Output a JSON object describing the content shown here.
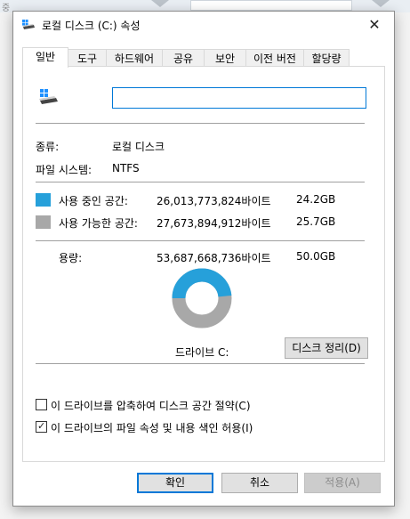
{
  "background": {
    "peek_text": "중"
  },
  "window": {
    "title": "로컬 디스크 (C:) 속성",
    "close_glyph": "✕"
  },
  "tabs": [
    {
      "label": "일반",
      "active": true
    },
    {
      "label": "도구"
    },
    {
      "label": "하드웨어"
    },
    {
      "label": "공유"
    },
    {
      "label": "보안"
    },
    {
      "label": "이전 버전"
    },
    {
      "label": "할당량"
    }
  ],
  "general": {
    "name_value": "",
    "type_label": "종류:",
    "type_value": "로컬 디스크",
    "fs_label": "파일 시스템:",
    "fs_value": "NTFS",
    "used": {
      "label": "사용 중인 공간:",
      "bytes": "26,013,773,824바이트",
      "size": "24.2GB",
      "color": "#26a0da"
    },
    "free": {
      "label": "사용 가능한 공간:",
      "bytes": "27,673,894,912바이트",
      "size": "25.7GB",
      "color": "#a8a8a8"
    },
    "capacity": {
      "label": "용량:",
      "bytes": "53,687,668,736바이트",
      "size": "50.0GB"
    },
    "used_fraction": 0.4845,
    "drive_label": "드라이브 C:",
    "cleanup_button": "디스크 정리(D)",
    "compress_checkbox": {
      "label": "이 드라이브를 압축하여 디스크 공간 절약(C)",
      "checked": false
    },
    "index_checkbox": {
      "label": "이 드라이브의 파일 속성 및 내용 색인 허용(I)",
      "checked": true
    },
    "check_glyph": "✓"
  },
  "buttons": {
    "ok": "확인",
    "cancel": "취소",
    "apply": "적용(A)"
  },
  "icons": {
    "title_icon": "drive-icon",
    "drive_icon": "drive-icon",
    "close_icon": "close-icon",
    "check_icon": "checkmark-icon"
  }
}
